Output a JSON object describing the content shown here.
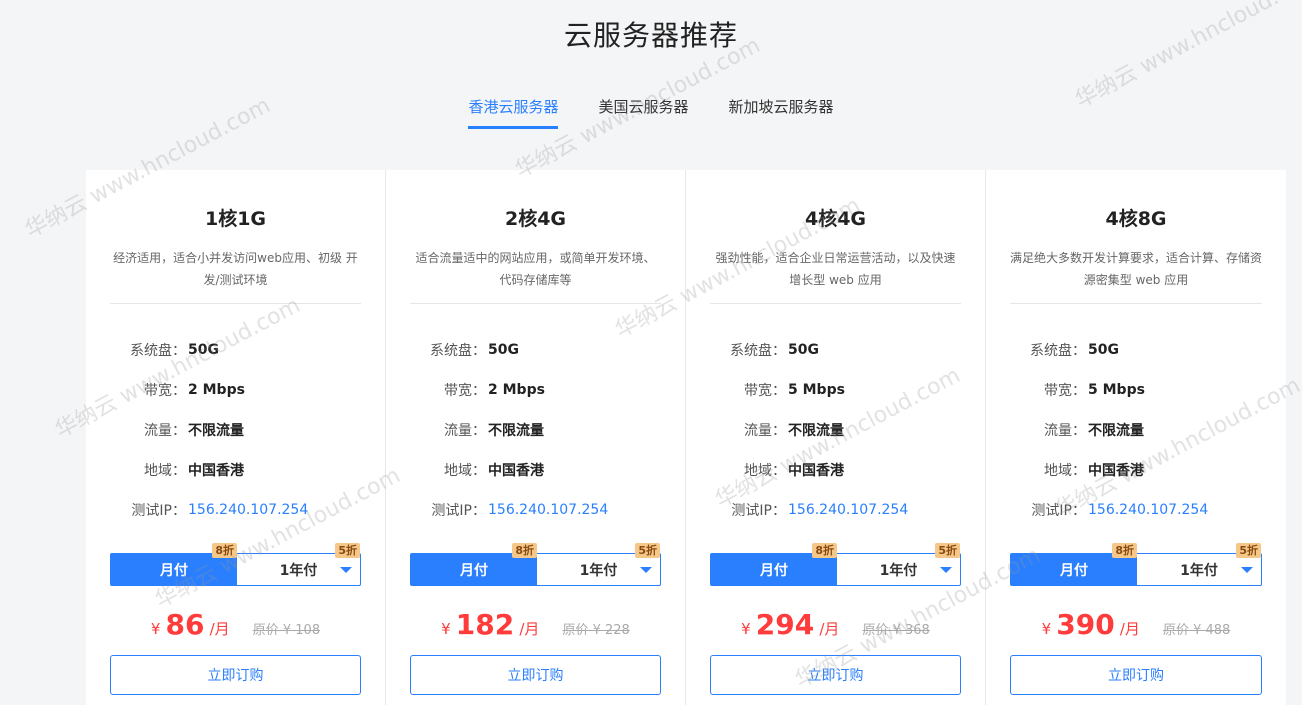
{
  "page": {
    "title": "云服务器推荐"
  },
  "tabs": [
    {
      "label": "香港云服务器",
      "active": true
    },
    {
      "label": "美国云服务器",
      "active": false
    },
    {
      "label": "新加坡云服务器",
      "active": false
    }
  ],
  "spec_labels": {
    "disk": "系统盘：",
    "bandwidth": "带宽：",
    "traffic": "流量：",
    "region": "地域：",
    "test_ip": "测试IP："
  },
  "pay_labels": {
    "monthly": "月付",
    "yearly": "1年付"
  },
  "price_labels": {
    "currency": "¥",
    "unit": "/月",
    "original_prefix": "原价 ¥ "
  },
  "buy_label": "立即订购",
  "plans": [
    {
      "name": "1核1G",
      "desc": "经济适用，适合小并发访问web应用、初级 开发/测试环境",
      "disk": "50G",
      "bandwidth": "2 Mbps",
      "traffic": "不限流量",
      "region": "中国香港",
      "test_ip": "156.240.107.254",
      "monthly_badge": "8折",
      "yearly_badge": "5折",
      "price": "86",
      "original": "原价 ¥ 108"
    },
    {
      "name": "2核4G",
      "desc": "适合流量适中的网站应用，或简单开发环境、代码存储库等",
      "disk": "50G",
      "bandwidth": "2 Mbps",
      "traffic": "不限流量",
      "region": "中国香港",
      "test_ip": "156.240.107.254",
      "monthly_badge": "8折",
      "yearly_badge": "5折",
      "price": "182",
      "original": "原价 ¥ 228"
    },
    {
      "name": "4核4G",
      "desc": "强劲性能，适合企业日常运营活动，以及快速增长型 web 应用",
      "disk": "50G",
      "bandwidth": "5 Mbps",
      "traffic": "不限流量",
      "region": "中国香港",
      "test_ip": "156.240.107.254",
      "monthly_badge": "8折",
      "yearly_badge": "5折",
      "price": "294",
      "original": "原价 ¥ 368"
    },
    {
      "name": "4核8G",
      "desc": "满足绝大多数开发计算要求，适合计算、存储资源密集型 web 应用",
      "disk": "50G",
      "bandwidth": "5 Mbps",
      "traffic": "不限流量",
      "region": "中国香港",
      "test_ip": "156.240.107.254",
      "monthly_badge": "8折",
      "yearly_badge": "5折",
      "price": "390",
      "original": "原价 ¥ 488"
    }
  ],
  "watermark": "华纳云 www.hncloud.com",
  "colors": {
    "accent": "#2a7fff",
    "price": "#ff3b3b",
    "badge": "#f5c88a"
  }
}
